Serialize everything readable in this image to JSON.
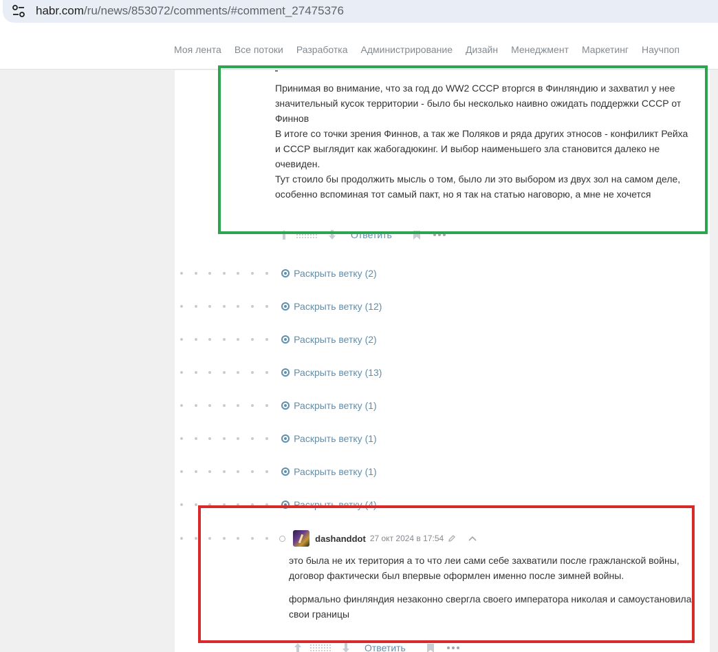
{
  "browser": {
    "url_host": "habr.com",
    "url_path": "/ru/news/853072/comments/#comment_27475376"
  },
  "nav": {
    "items": [
      "Моя лента",
      "Все потоки",
      "Разработка",
      "Администрирование",
      "Дизайн",
      "Менеджмент",
      "Маркетинг",
      "Научпоп"
    ]
  },
  "comment1": {
    "paragraphs": [
      "Принимая во внимание, что за год до WW2 СССР вторгся в Финляндию и захватил у нее значительный кусок территории - было бы несколько наивно ожидать поддержки СССР от Финнов",
      "В итоге со точки зрения Финнов, а так же Поляков и ряда других этносов - конфиликт Рейха и СССР выглядит как жабогадюкинг. И выбор наименьшего зла становится далеко не очевиден.",
      "Тут стоило бы продолжить мысль о том, было ли это выбором из двух зол на самом деле, особенно вспоминая тот самый пакт, но я так на статью наговорю, а мне не хочется"
    ],
    "reply_label": "Ответить"
  },
  "branches": [
    {
      "label": "Раскрыть ветку (2)"
    },
    {
      "label": "Раскрыть ветку (12)"
    },
    {
      "label": "Раскрыть ветку (2)"
    },
    {
      "label": "Раскрыть ветку (13)"
    },
    {
      "label": "Раскрыть ветку (1)"
    },
    {
      "label": "Раскрыть ветку (1)"
    },
    {
      "label": "Раскрыть ветку (1)"
    },
    {
      "label": "Раскрыть ветку (4)"
    }
  ],
  "comment2": {
    "username": "dashanddot",
    "date": "27 окт 2024 в 17:54",
    "paragraphs": [
      "это была не их територия а то что леи сами себе захватили после гражланской войны, договор фактически был впервые оформлен именно после зимней войны.",
      "формально финляндия незаконно свергла своего императора николая и самоустановила свои границы"
    ],
    "reply_label": "Ответить"
  },
  "highlight_colors": {
    "green": "#2da44e",
    "red": "#d82a2a"
  }
}
